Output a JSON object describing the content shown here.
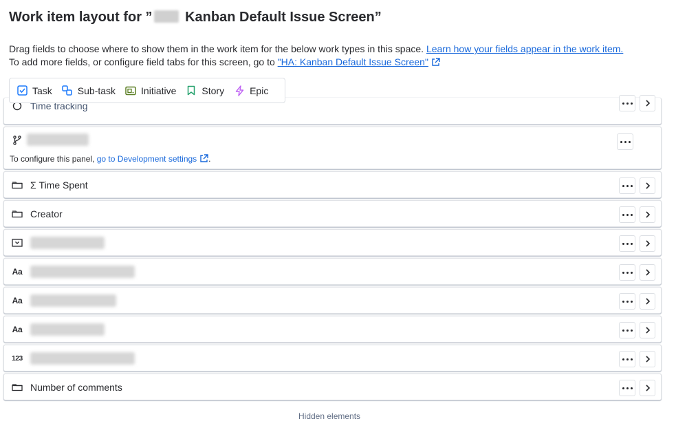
{
  "header": {
    "title_prefix": "Work item layout for ”",
    "title_suffix": " Kanban Default Issue Screen”"
  },
  "description": {
    "line1_text": "Drag fields to choose where to show them in the work item for the below work types in this space. ",
    "line1_link": "Learn how your fields appear in the work item.",
    "line2_text": "To add more fields, or configure field tabs for this screen, go to ",
    "line2_link": "\"HA: Kanban Default Issue Screen\""
  },
  "work_types": [
    {
      "label": "Task",
      "icon": "checkbox-icon",
      "color": "#1d7afc"
    },
    {
      "label": "Sub-task",
      "icon": "subtask-icon",
      "color": "#1d7afc"
    },
    {
      "label": "Initiative",
      "icon": "initiative-icon",
      "color": "#5b7f24"
    },
    {
      "label": "Story",
      "icon": "bookmark-icon",
      "color": "#22a06b"
    },
    {
      "label": "Epic",
      "icon": "lightning-icon",
      "color": "#bf63f3"
    }
  ],
  "fields": {
    "partial_label": "Time tracking",
    "development_note": "To configure this panel, ",
    "development_link": "go to Development settings",
    "development_note_end": ".",
    "time_spent": "Σ Time Spent",
    "creator": "Creator",
    "text_icon": "Aa",
    "number_icon": "123",
    "number_of_comments": "Number of comments"
  },
  "footer": {
    "hidden_label": "Hidden elements"
  },
  "colors": {
    "link": "#1868db",
    "text": "#292a2e",
    "border": "#dcdfe4"
  }
}
